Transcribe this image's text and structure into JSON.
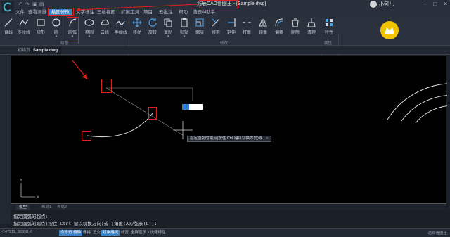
{
  "app": {
    "title": "浩辰CAD看图王",
    "title_suffix": " - [Sample.dwg]",
    "user": "小河儿"
  },
  "menu": {
    "items": [
      {
        "label": "文件"
      },
      {
        "label": "查看测量"
      },
      {
        "label": "绘图修改"
      },
      {
        "label": "文字标注"
      },
      {
        "label": "三维视图"
      },
      {
        "label": "扩展工具"
      },
      {
        "label": "项目"
      },
      {
        "label": "云批注"
      },
      {
        "label": "帮助"
      },
      {
        "label": "浩辰AI助手"
      }
    ],
    "active_index": 2
  },
  "ribbon": {
    "tools": [
      {
        "label": "直线",
        "icon": "line-icon"
      },
      {
        "label": "多段线",
        "icon": "polyline-icon"
      },
      {
        "label": "矩形",
        "icon": "rectangle-icon"
      },
      {
        "label": "圆",
        "icon": "circle-icon"
      },
      {
        "label": "圆弧",
        "icon": "arc-icon"
      },
      {
        "label": "椭圆",
        "icon": "ellipse-icon"
      },
      {
        "label": "云线",
        "icon": "cloud-icon"
      },
      {
        "label": "手绘线",
        "icon": "freehand-icon"
      },
      {
        "label": "移动",
        "icon": "move-icon"
      },
      {
        "label": "旋转",
        "icon": "rotate-icon"
      },
      {
        "label": "复制",
        "icon": "copy-icon"
      },
      {
        "label": "粘贴",
        "icon": "paste-icon"
      },
      {
        "label": "缩放",
        "icon": "scale-icon"
      },
      {
        "label": "修剪",
        "icon": "trim-icon"
      },
      {
        "label": "打断",
        "icon": "break-icon"
      },
      {
        "label": "镜像",
        "icon": "mirror-icon"
      },
      {
        "label": "偏移",
        "icon": "offset-icon"
      },
      {
        "label": "删除",
        "icon": "delete-icon"
      },
      {
        "label": "清理",
        "icon": "purge-icon"
      },
      {
        "label": "特性",
        "icon": "properties-icon"
      }
    ],
    "group_draw": "绘图",
    "group_modify": "修改",
    "group_properties": "属性"
  },
  "doc_tabs": [
    {
      "label": "初始页"
    },
    {
      "label": "Sample.dwg"
    }
  ],
  "canvas": {
    "tooltip": "指定圆弧的端点(按住 Ctrl 键以切换方向)或",
    "tooltip_close": "×",
    "axis_y": "Y",
    "axis_x": "X"
  },
  "layout_tabs": [
    {
      "label": "模型"
    },
    {
      "label": "布局1"
    },
    {
      "label": "布局2"
    }
  ],
  "command": {
    "line1": "指定圆弧的起点:",
    "line2": "指定圆弧的端点(按住 Ctrl 键以切换方向)或 [角度(A)/弦长(L)]:"
  },
  "status": {
    "coords": "-147211, 36398, 0",
    "buttons": [
      {
        "label": "命令行",
        "on": true
      },
      {
        "label": "极轴",
        "on": true
      },
      {
        "label": "栅格",
        "on": false
      },
      {
        "label": "正交",
        "on": false
      },
      {
        "label": "对象捕捉",
        "on": true
      },
      {
        "label": "线宽",
        "on": false
      },
      {
        "label": "全屏显示",
        "on": false
      },
      {
        "label": "• 快捷特性",
        "on": false
      }
    ],
    "brand": "浩辰看图王"
  },
  "colors": {
    "accent": "#3b82c4",
    "annotation_red": "#e0201c",
    "canvas_bg": "#000000",
    "badge_yellow": "#f2c400"
  }
}
